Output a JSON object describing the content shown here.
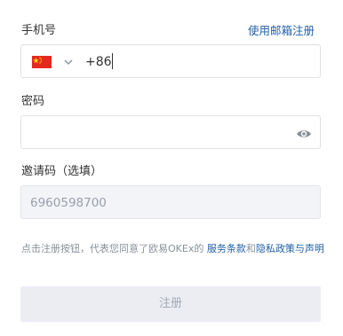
{
  "phone": {
    "label": "手机号",
    "switch_link": "使用邮箱注册",
    "country_code": "+86",
    "flag_icon": "china-flag-icon"
  },
  "password": {
    "label": "密码",
    "visibility_icon": "eye-icon"
  },
  "invite": {
    "label": "邀请码（选填）",
    "value": "6960598700"
  },
  "terms": {
    "prefix": "点击注册按钮，代表您同意了欧易OKEx的 ",
    "service_terms": "服务条款",
    "and": "和",
    "privacy_policy": "隐私政策与声明"
  },
  "submit": {
    "label": "注册"
  },
  "colors": {
    "link": "#1f5fa8",
    "border": "#dfe1e6",
    "disabled_bg": "#f3f4f8",
    "button_bg": "#ebedf3",
    "button_text": "#a3a8b3",
    "flag_red": "#e4291f",
    "flag_star": "#ffde00"
  }
}
